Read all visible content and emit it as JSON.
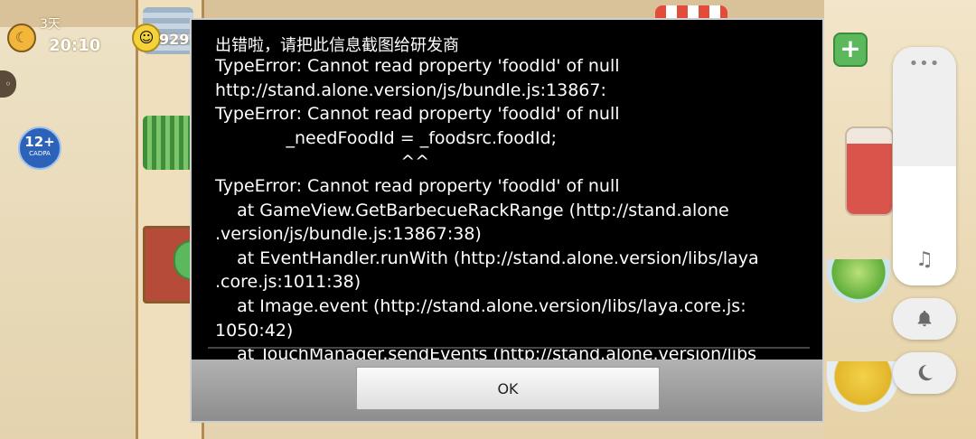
{
  "game_hud": {
    "day": "3天",
    "time": "20:10",
    "coins": "929",
    "age_rating": "12+",
    "age_rating_sub": "CADPA"
  },
  "dialog": {
    "title": "出错啦，请把此信息截图给研发商",
    "lines": [
      "TypeError: Cannot read property 'foodId' of null",
      "http://stand.alone.version/js/bundle.js:13867:",
      "TypeError: Cannot read property 'foodId' of null",
      "             _needFoodId = _foodsrc.foodId;",
      "                                  ^^",
      "TypeError: Cannot read property 'foodId' of null",
      "    at GameView.GetBarbecueRackRange (http://stand.alone",
      ".version/js/bundle.js:13867:38)",
      "    at EventHandler.runWith (http://stand.alone.version/libs/laya",
      ".core.js:1011:38)",
      "    at Image.event (http://stand.alone.version/libs/laya.core.js:",
      "1050:42)",
      "    at TouchManager.sendEvents (http://stand.alone.version/libs"
    ],
    "ok_label": "OK"
  },
  "volume_panel": {
    "level": 0.5,
    "more_icon": "more-dots-icon",
    "music_icon": "music-note-icon",
    "bell_icon": "bell-icon",
    "dnd_icon": "moon-icon"
  },
  "colors": {
    "dialog_bg": "#000000",
    "dialog_text": "#ffffff",
    "footer_bg": "#a0a0a0",
    "panel_bg": "#efefef"
  }
}
